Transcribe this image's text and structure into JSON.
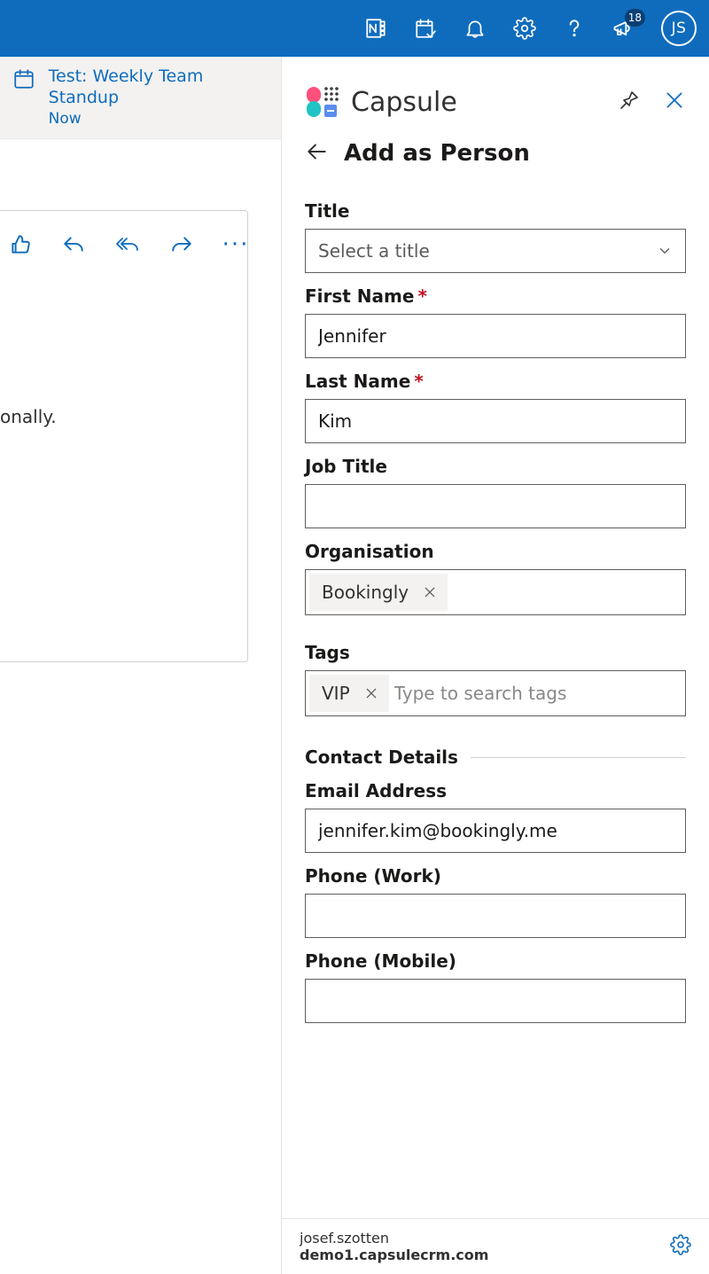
{
  "topbar": {
    "notification_count": "18",
    "avatar_initials": "JS"
  },
  "calendar_event": {
    "title": "Test: Weekly Team Standup",
    "subtitle": "Now"
  },
  "reading_pane": {
    "fragment": "onally."
  },
  "addin": {
    "brand": "Capsule",
    "screen_title": "Add as Person",
    "fields": {
      "title_label": "Title",
      "title_placeholder": "Select a title",
      "first_name_label": "First Name",
      "first_name_value": "Jennifer",
      "last_name_label": "Last Name",
      "last_name_value": "Kim",
      "job_title_label": "Job Title",
      "job_title_value": "",
      "organisation_label": "Organisation",
      "organisation_chip": "Bookingly",
      "tags_label": "Tags",
      "tags_chip": "VIP",
      "tags_placeholder": "Type to search tags",
      "section_contact": "Contact Details",
      "email_label": "Email Address",
      "email_value": "jennifer.kim@bookingly.me",
      "phone_work_label": "Phone (Work)",
      "phone_work_value": "",
      "phone_mobile_label": "Phone (Mobile)",
      "phone_mobile_value": ""
    },
    "footer": {
      "user": "josef.szotten",
      "domain": "demo1.capsulecrm.com"
    }
  }
}
